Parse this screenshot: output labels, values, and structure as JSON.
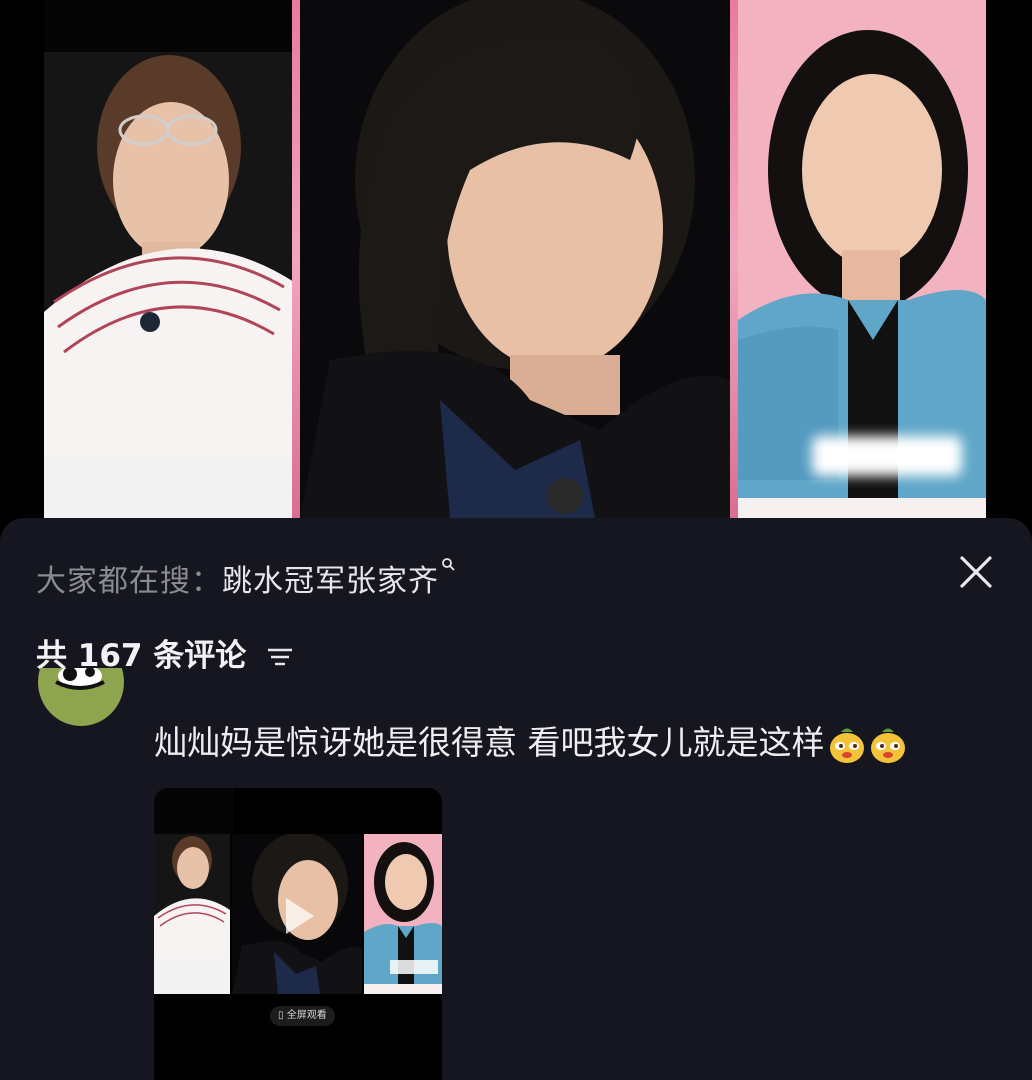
{
  "search_bar": {
    "prefix": "大家都在搜：",
    "term": "跳水冠军张家齐",
    "icon": "search-icon"
  },
  "comments_header": {
    "count_label": "共 167 条评论",
    "sort_icon": "sort-lines-icon"
  },
  "close_icon": "close-icon",
  "comment": {
    "text": "灿灿妈是惊讶她是很得意 看吧我女儿就是这样",
    "emojis": [
      "smug-face-emoji",
      "smug-face-emoji"
    ]
  },
  "video_thumb": {
    "fullscreen_label": "全屏观看"
  },
  "colors": {
    "sheet_bg": "#161620",
    "pink_stage": "#f0a9b8",
    "text_primary": "#eeeef0",
    "text_muted": "#8b8b92"
  }
}
